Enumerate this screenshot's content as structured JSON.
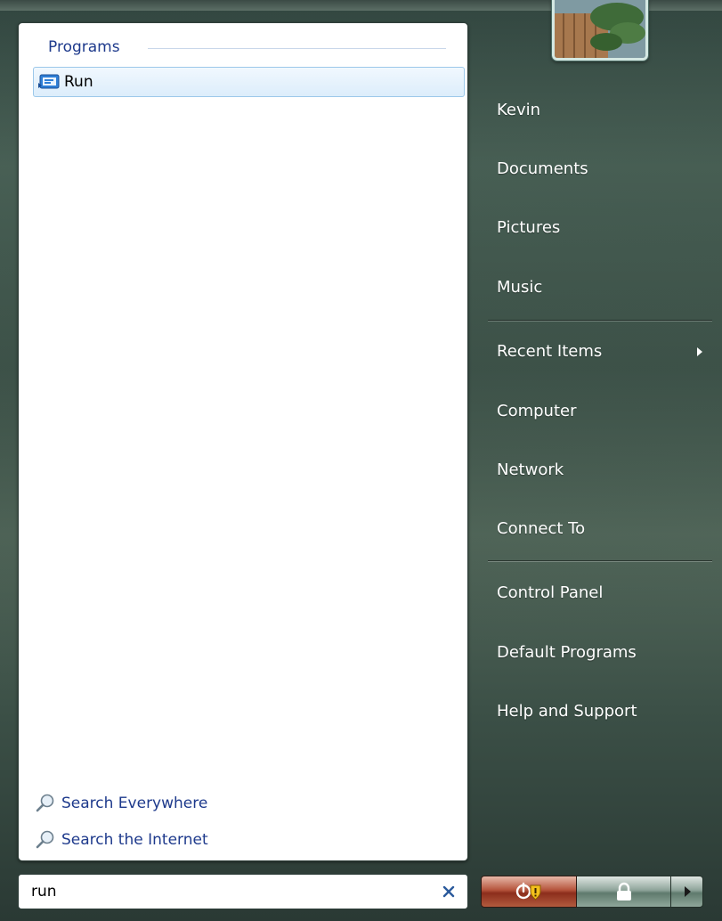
{
  "left_panel": {
    "section_header": "Programs",
    "results": [
      {
        "label": "Run",
        "icon": "run-icon"
      }
    ],
    "search_links": [
      {
        "label": "Search Everywhere",
        "icon": "magnifier-icon"
      },
      {
        "label": "Search the Internet",
        "icon": "magnifier-icon"
      }
    ]
  },
  "search": {
    "value": "run",
    "clear_icon": "close-icon"
  },
  "right_panel": {
    "user_picture_icon": "user-picture",
    "items": [
      "Kevin",
      "Documents",
      "Pictures",
      "Music",
      "Recent Items",
      "Computer",
      "Network",
      "Connect To",
      "Control Panel",
      "Default Programs",
      "Help and Support"
    ]
  },
  "buttons": {
    "power_icon": "power-shield-icon",
    "lock_icon": "lock-icon",
    "more_icon": "chevron-right-icon"
  },
  "colors": {
    "link_blue": "#1e3a8c",
    "selection": "#dcedfb",
    "power_red": "#b5533b"
  }
}
